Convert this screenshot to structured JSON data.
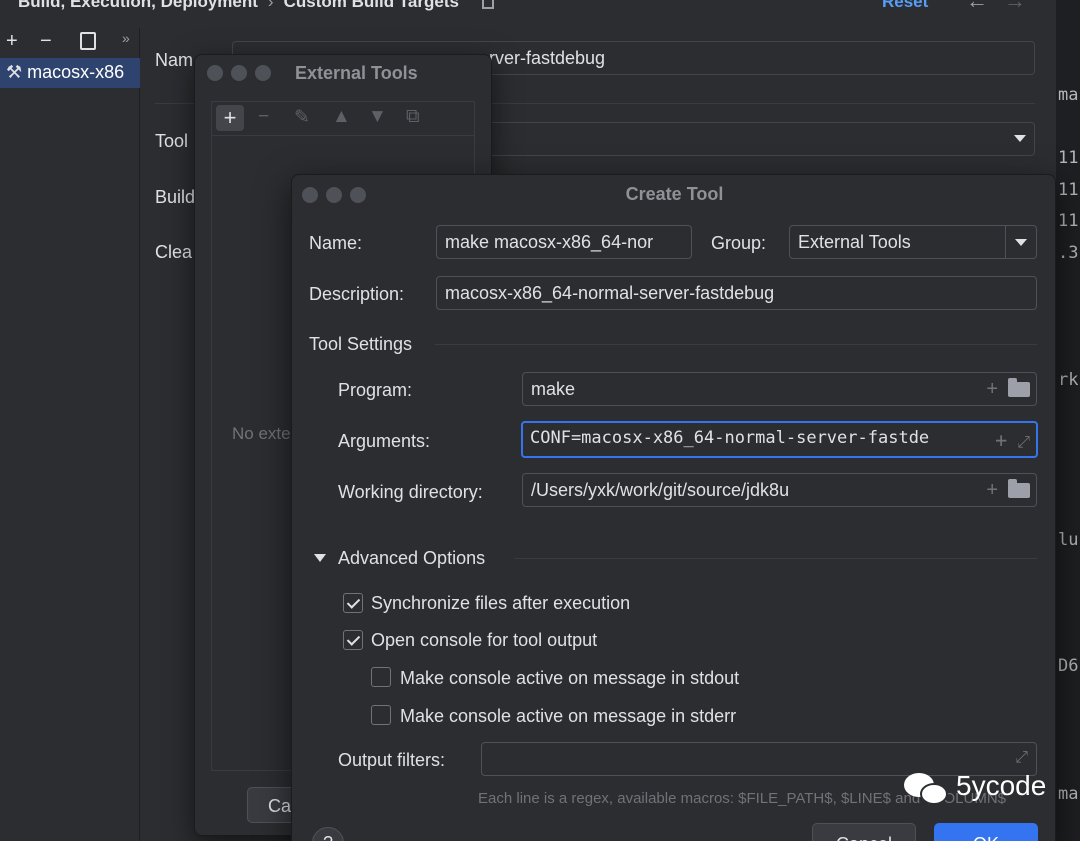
{
  "settings": {
    "breadcrumb": [
      "Build, Execution, Deployment",
      "Custom Build Targets"
    ],
    "reset_label": "Reset",
    "left_toolbar": {
      "add": "+",
      "remove": "−",
      "more": "»"
    },
    "selected_target": "macosx-x86",
    "labels": {
      "name": "Nam",
      "tool": "Tool",
      "build": "Build",
      "clean": "Clea"
    },
    "name_value_fragment": "rver-fastdebug",
    "right_fragments": [
      "ma",
      "11",
      "11",
      "11",
      ".3",
      "rk",
      "lu",
      "D6",
      "ma"
    ]
  },
  "external_tools": {
    "title": "External Tools",
    "empty_text": "No exter",
    "cancel_label": "Ca"
  },
  "create_tool": {
    "title": "Create Tool",
    "name_label": "Name:",
    "name_value": "make macosx-x86_64-nor",
    "group_label": "Group:",
    "group_value": "External Tools",
    "description_label": "Description:",
    "description_value": "macosx-x86_64-normal-server-fastdebug",
    "tool_settings_label": "Tool Settings",
    "program_label": "Program:",
    "program_value": "make",
    "arguments_label": "Arguments:",
    "arguments_value": "CONF=macosx-x86_64-normal-server-fastde",
    "working_dir_label": "Working directory:",
    "working_dir_value": "/Users/yxk/work/git/source/jdk8u",
    "advanced_label": "Advanced Options",
    "options": [
      {
        "label": "Synchronize files after execution",
        "checked": true
      },
      {
        "label": "Open console for tool output",
        "checked": true
      },
      {
        "label": "Make console active on message in stdout",
        "checked": false
      },
      {
        "label": "Make console active on message in stderr",
        "checked": false
      }
    ],
    "output_filters_label": "Output filters:",
    "hint": "Each line is a regex, available macros: $FILE_PATH$, $LINE$ and $COLUMN$",
    "cancel_label": "Cancel",
    "ok_label": "OK",
    "help_label": "?"
  },
  "watermark": "5ycode",
  "colors": {
    "accent": "#3574f0",
    "link": "#589df6",
    "background": "#2b2d30"
  }
}
